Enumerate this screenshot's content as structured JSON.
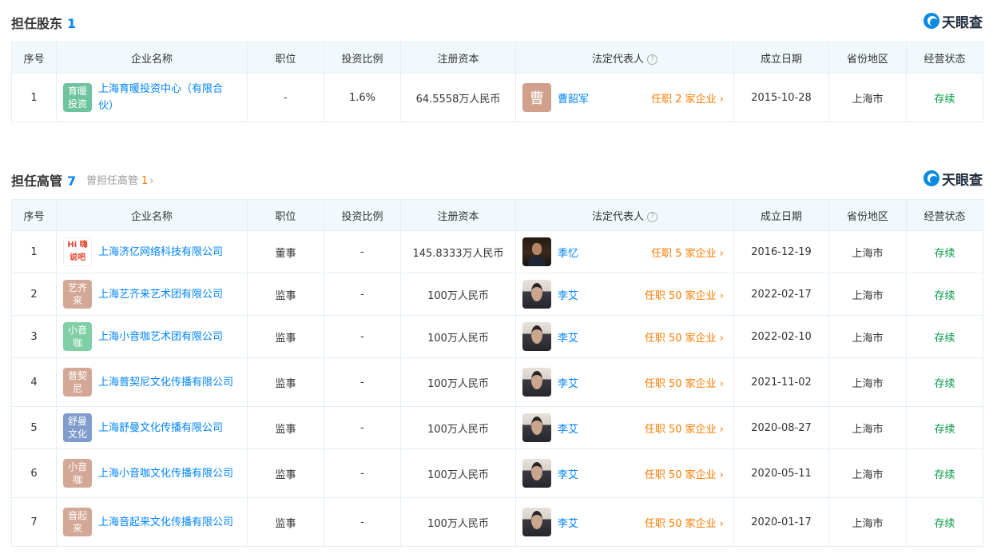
{
  "brand": "天眼查",
  "shareholder": {
    "title": "担任股东",
    "count": "1",
    "headers": [
      "序号",
      "企业名称",
      "职位",
      "投资比例",
      "注册资本",
      "法定代表人",
      "成立日期",
      "省份地区",
      "经营状态"
    ],
    "rows": [
      {
        "no": "1",
        "logo_text": "育暖投资",
        "logo_color": "#6fc4a0",
        "company": "上海育暖投资中心（有限合伙）",
        "position": "-",
        "ratio": "1.6%",
        "capital": "64.5558万人民币",
        "rep_avatar": "曹",
        "rep_avatar_color": "#d0a08c",
        "rep": "曹韶军",
        "tenure": "任职 2 家企业",
        "date": "2015-10-28",
        "region": "上海市",
        "status": "存续"
      }
    ]
  },
  "executive": {
    "title": "担任高管",
    "count": "7",
    "former_label": "曾担任高管",
    "former_count": "1",
    "headers": [
      "序号",
      "企业名称",
      "职位",
      "投资比例",
      "注册资本",
      "法定代表人",
      "成立日期",
      "省份地区",
      "经营状态"
    ],
    "rows": [
      {
        "no": "1",
        "logo_text": "Hi 嗨说吧",
        "logo_color": "#ffffff",
        "company": "上海济亿网络科技有限公司",
        "position": "董事",
        "ratio": "-",
        "capital": "145.8333万人民币",
        "rep": "季忆",
        "tenure": "任职 5 家企业",
        "date": "2016-12-19",
        "region": "上海市",
        "status": "存续"
      },
      {
        "no": "2",
        "logo_text": "艺齐来",
        "logo_color": "#d4a896",
        "company": "上海艺齐来艺术团有限公司",
        "position": "监事",
        "ratio": "-",
        "capital": "100万人民币",
        "rep": "李艾",
        "tenure": "任职 50 家企业",
        "date": "2022-02-17",
        "region": "上海市",
        "status": "存续"
      },
      {
        "no": "3",
        "logo_text": "小音咖",
        "logo_color": "#7fcfa6",
        "company": "上海小音咖艺术团有限公司",
        "position": "监事",
        "ratio": "-",
        "capital": "100万人民币",
        "rep": "李艾",
        "tenure": "任职 50 家企业",
        "date": "2022-02-10",
        "region": "上海市",
        "status": "存续"
      },
      {
        "no": "4",
        "logo_text": "普契尼",
        "logo_color": "#d4a896",
        "company": "上海普契尼文化传播有限公司",
        "position": "监事",
        "ratio": "-",
        "capital": "100万人民币",
        "rep": "李艾",
        "tenure": "任职 50 家企业",
        "date": "2021-11-02",
        "region": "上海市",
        "status": "存续"
      },
      {
        "no": "5",
        "logo_text": "舒曼文化",
        "logo_color": "#7f9ccc",
        "company": "上海舒曼文化传播有限公司",
        "position": "监事",
        "ratio": "-",
        "capital": "100万人民币",
        "rep": "李艾",
        "tenure": "任职 50 家企业",
        "date": "2020-08-27",
        "region": "上海市",
        "status": "存续"
      },
      {
        "no": "6",
        "logo_text": "小音咖",
        "logo_color": "#d4a896",
        "company": "上海小音咖文化传播有限公司",
        "position": "监事",
        "ratio": "-",
        "capital": "100万人民币",
        "rep": "李艾",
        "tenure": "任职 50 家企业",
        "date": "2020-05-11",
        "region": "上海市",
        "status": "存续"
      },
      {
        "no": "7",
        "logo_text": "音起来",
        "logo_color": "#d4a896",
        "company": "上海音起来文化传播有限公司",
        "position": "监事",
        "ratio": "-",
        "capital": "100万人民币",
        "rep": "李艾",
        "tenure": "任职 50 家企业",
        "date": "2020-01-17",
        "region": "上海市",
        "status": "存续"
      }
    ]
  }
}
